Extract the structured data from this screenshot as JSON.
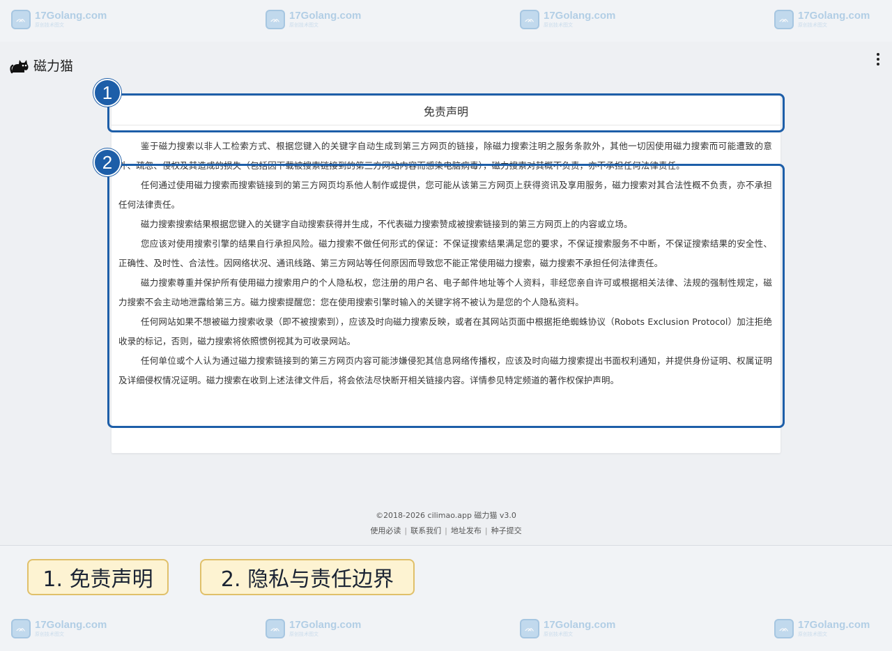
{
  "watermark": {
    "name": "17Golang.com",
    "sub": "原创技术图文"
  },
  "app": {
    "brand_name": "磁力猫",
    "logo_icon": "cat-icon",
    "menu_icon": "more-vertical-icon"
  },
  "disclaimer": {
    "title": "免责声明",
    "paragraphs": [
      "鉴于磁力搜索以非人工检索方式、根据您键入的关键字自动生成到第三方网页的链接，除磁力搜索注明之服务条款外，其他一切因使用磁力搜索而可能遭致的意外、疏忽、侵权及其造成的损失（包括因下载被搜索链接到的第三方网站内容而感染电脑病毒），磁力搜索对其概不负责，亦不承担任何法律责任。",
      "任何通过使用磁力搜索而搜索链接到的第三方网页均系他人制作或提供，您可能从该第三方网页上获得资讯及享用服务，磁力搜索对其合法性概不负责，亦不承担任何法律责任。",
      "磁力搜索搜索结果根据您键入的关键字自动搜索获得并生成，不代表磁力搜索赞成被搜索链接到的第三方网页上的内容或立场。",
      "您应该对使用搜索引擎的结果自行承担风险。磁力搜索不做任何形式的保证：不保证搜索结果满足您的要求，不保证搜索服务不中断，不保证搜索结果的安全性、正确性、及时性、合法性。因网络状况、通讯线路、第三方网站等任何原因而导致您不能正常使用磁力搜索，磁力搜索不承担任何法律责任。",
      "磁力搜索尊重并保护所有使用磁力搜索用户的个人隐私权，您注册的用户名、电子邮件地址等个人资料，非经您亲自许可或根据相关法律、法规的强制性规定，磁力搜索不会主动地泄露给第三方。磁力搜索提醒您：您在使用搜索引擎时输入的关键字将不被认为是您的个人隐私资料。",
      "任何网站如果不想被磁力搜索收录（即不被搜索到），应该及时向磁力搜索反映，或者在其网站页面中根据拒绝蜘蛛协议（Robots Exclusion Protocol）加注拒绝收录的标记，否则，磁力搜索将依照惯例视其为可收录网站。",
      "任何单位或个人认为通过磁力搜索链接到的第三方网页内容可能涉嫌侵犯其信息网络传播权，应该及时向磁力搜索提出书面权利通知，并提供身份证明、权属证明及详细侵权情况证明。磁力搜索在收到上述法律文件后，将会依法尽快断开相关链接内容。详情参见特定频道的著作权保护声明。"
    ]
  },
  "annotations": {
    "badge1": "1",
    "badge2": "2",
    "caption1": "1. 免责声明",
    "caption2": "2. 隐私与责任边界",
    "highlight_color": "#1d5ea8",
    "caption_bg": "#fdf3d2"
  },
  "footer": {
    "copyright": "©2018-2026 cilimao.app 磁力猫 v3.0",
    "links": [
      "使用必读",
      "联系我们",
      "地址发布",
      "种子提交"
    ],
    "separator": "|"
  }
}
